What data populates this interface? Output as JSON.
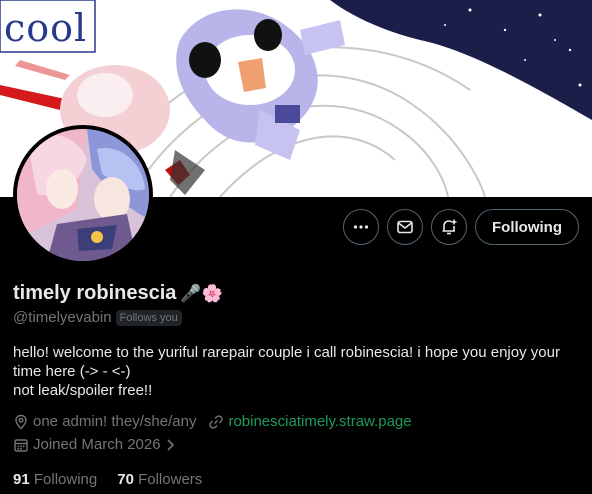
{
  "banner": {
    "caption": "cool",
    "image_icon": "fan-art-banner-image"
  },
  "avatar": {
    "icon": "profile-avatar-image"
  },
  "actions": {
    "more_icon": "more-icon",
    "message_icon": "message-icon",
    "notify_icon": "notification-bell-icon",
    "follow_label": "Following"
  },
  "profile": {
    "display_name": "timely robinescia",
    "name_emojis": "🎤🌸",
    "handle": "@timelyevabin",
    "follows_you": "Follows you",
    "bio_lines": [
      "hello! welcome to the yuriful rarepair couple i call robinescia! i hope you enjoy your time here (-> ‑ <-)",
      "not leak/spoiler free!!"
    ],
    "location": "one admin! they/she/any",
    "link": "robinesciatimely.straw.page",
    "joined": "Joined March 2026"
  },
  "stats": {
    "following_count": "91",
    "following_label": "Following",
    "followers_count": "70",
    "followers_label": "Followers"
  },
  "colors": {
    "background": "#000000",
    "text": "#e7e9ea",
    "muted": "#71767b",
    "link": "#1d9b5a",
    "border": "#536471"
  }
}
